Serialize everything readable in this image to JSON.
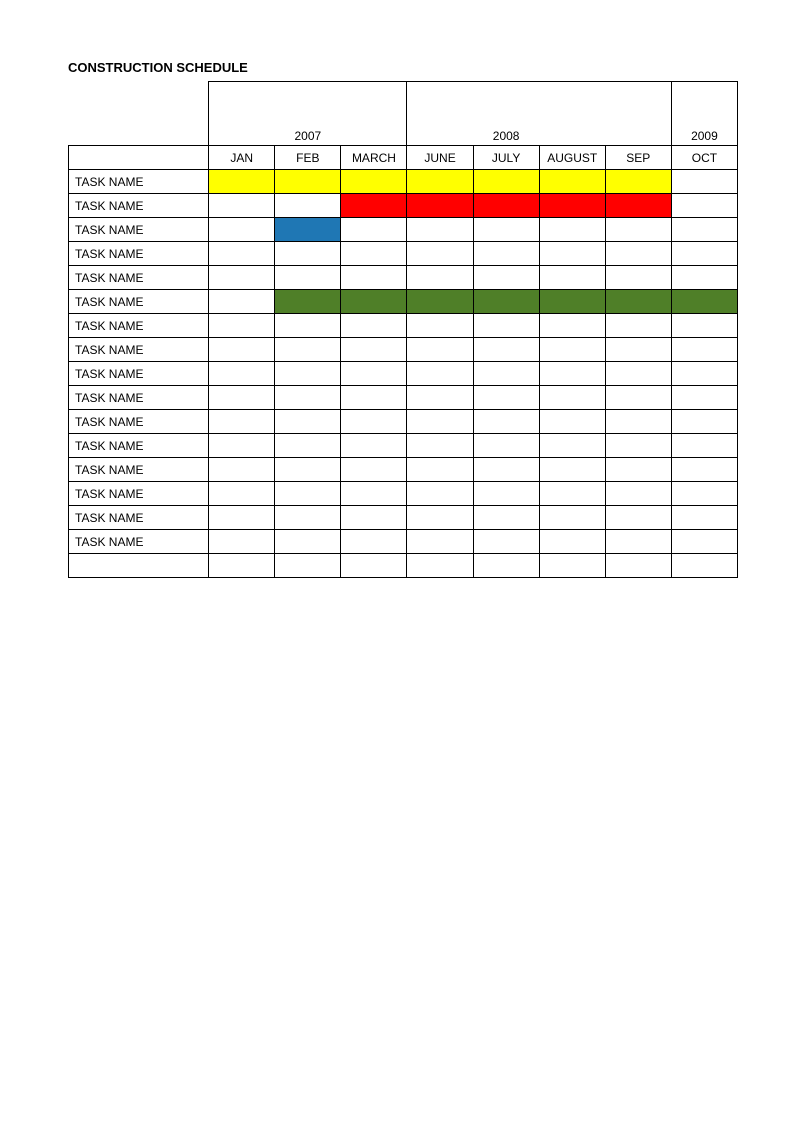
{
  "title": "CONSTRUCTION SCHEDULE",
  "years": [
    "2007",
    "2008",
    "2009"
  ],
  "months": [
    "JAN",
    "FEB",
    "MARCH",
    "JUNE",
    "JULY",
    "AUGUST",
    "SEP",
    "OCT"
  ],
  "tasks": [
    {
      "name": "TASK NAME",
      "cells": [
        "yellow",
        "yellow",
        "yellow",
        "yellow",
        "yellow",
        "yellow",
        "yellow",
        ""
      ]
    },
    {
      "name": "TASK NAME",
      "cells": [
        "",
        "",
        "red",
        "red",
        "red",
        "red",
        "red",
        ""
      ]
    },
    {
      "name": "TASK NAME",
      "cells": [
        "",
        "blue",
        "",
        "",
        "",
        "",
        "",
        ""
      ]
    },
    {
      "name": "TASK NAME",
      "cells": [
        "",
        "",
        "",
        "",
        "",
        "",
        "",
        ""
      ]
    },
    {
      "name": "TASK NAME",
      "cells": [
        "",
        "",
        "",
        "",
        "",
        "",
        "",
        ""
      ]
    },
    {
      "name": "TASK NAME",
      "cells": [
        "",
        "green",
        "green",
        "green",
        "green",
        "green",
        "green",
        "green"
      ]
    },
    {
      "name": "TASK NAME",
      "cells": [
        "",
        "",
        "",
        "",
        "",
        "",
        "",
        ""
      ]
    },
    {
      "name": "TASK NAME",
      "cells": [
        "",
        "",
        "",
        "",
        "",
        "",
        "",
        ""
      ]
    },
    {
      "name": "TASK NAME",
      "cells": [
        "",
        "",
        "",
        "",
        "",
        "",
        "",
        ""
      ]
    },
    {
      "name": "TASK NAME",
      "cells": [
        "",
        "",
        "",
        "",
        "",
        "",
        "",
        ""
      ]
    },
    {
      "name": "TASK NAME",
      "cells": [
        "",
        "",
        "",
        "",
        "",
        "",
        "",
        ""
      ]
    },
    {
      "name": "TASK NAME",
      "cells": [
        "",
        "",
        "",
        "",
        "",
        "",
        "",
        ""
      ]
    },
    {
      "name": "TASK NAME",
      "cells": [
        "",
        "",
        "",
        "",
        "",
        "",
        "",
        ""
      ]
    },
    {
      "name": "TASK NAME",
      "cells": [
        "",
        "",
        "",
        "",
        "",
        "",
        "",
        ""
      ]
    },
    {
      "name": "TASK NAME",
      "cells": [
        "",
        "",
        "",
        "",
        "",
        "",
        "",
        ""
      ]
    },
    {
      "name": "TASK NAME",
      "cells": [
        "",
        "",
        "",
        "",
        "",
        "",
        "",
        ""
      ]
    },
    {
      "name": "",
      "cells": [
        "",
        "",
        "",
        "",
        "",
        "",
        "",
        ""
      ]
    }
  ],
  "chart_data": {
    "type": "table",
    "title": "CONSTRUCTION SCHEDULE",
    "columns": [
      "JAN 2007",
      "FEB 2007",
      "MARCH 2007",
      "JUNE 2008",
      "JULY 2008",
      "AUGUST 2008",
      "SEP 2008",
      "OCT 2009"
    ],
    "rows": [
      {
        "task": "TASK NAME",
        "bar": {
          "start": 0,
          "end": 6,
          "color": "yellow"
        }
      },
      {
        "task": "TASK NAME",
        "bar": {
          "start": 2,
          "end": 6,
          "color": "red"
        }
      },
      {
        "task": "TASK NAME",
        "bar": {
          "start": 1,
          "end": 1,
          "color": "blue"
        }
      },
      {
        "task": "TASK NAME",
        "bar": null
      },
      {
        "task": "TASK NAME",
        "bar": null
      },
      {
        "task": "TASK NAME",
        "bar": {
          "start": 1,
          "end": 7,
          "color": "green"
        }
      },
      {
        "task": "TASK NAME",
        "bar": null
      },
      {
        "task": "TASK NAME",
        "bar": null
      },
      {
        "task": "TASK NAME",
        "bar": null
      },
      {
        "task": "TASK NAME",
        "bar": null
      },
      {
        "task": "TASK NAME",
        "bar": null
      },
      {
        "task": "TASK NAME",
        "bar": null
      },
      {
        "task": "TASK NAME",
        "bar": null
      },
      {
        "task": "TASK NAME",
        "bar": null
      },
      {
        "task": "TASK NAME",
        "bar": null
      },
      {
        "task": "TASK NAME",
        "bar": null
      }
    ]
  }
}
